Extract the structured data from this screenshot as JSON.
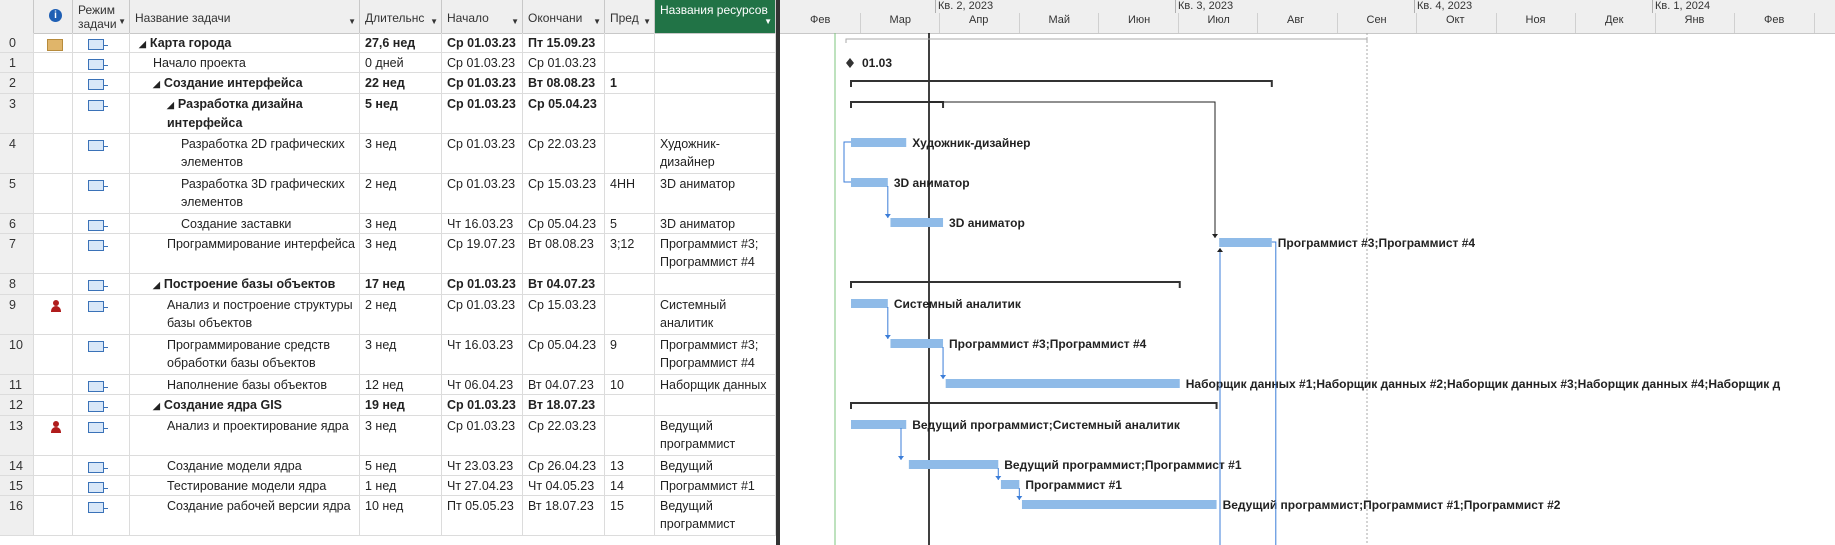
{
  "columns": {
    "info": "i",
    "mode": "Режим задачи",
    "name": "Название задачи",
    "duration": "Длительнс",
    "start": "Начало",
    "finish": "Окончани",
    "pred": "Пред",
    "resources": "Названия ресурсов"
  },
  "tasks": [
    {
      "id": "0",
      "name": "Карта города",
      "duration": "27,6 нед",
      "start": "Ср 01.03.23",
      "finish": "Пт 15.09.23",
      "pred": "",
      "resources": ""
    },
    {
      "id": "1",
      "name": "Начало проекта",
      "duration": "0 дней",
      "start": "Ср 01.03.23",
      "finish": "Ср 01.03.23",
      "pred": "",
      "resources": ""
    },
    {
      "id": "2",
      "name": "Создание интерфейса",
      "duration": "22 нед",
      "start": "Ср 01.03.23",
      "finish": "Вт 08.08.23",
      "pred": "1",
      "resources": ""
    },
    {
      "id": "3",
      "name": "Разработка дизайна интерфейса",
      "duration": "5 нед",
      "start": "Ср 01.03.23",
      "finish": "Ср 05.04.23",
      "pred": "",
      "resources": ""
    },
    {
      "id": "4",
      "name": "Разработка 2D графических элементов",
      "duration": "3 нед",
      "start": "Ср 01.03.23",
      "finish": "Ср 22.03.23",
      "pred": "",
      "resources": "Художник-дизайнер"
    },
    {
      "id": "5",
      "name": "Разработка 3D графических элементов",
      "duration": "2 нед",
      "start": "Ср 01.03.23",
      "finish": "Ср 15.03.23",
      "pred": "4НН",
      "resources": "3D аниматор"
    },
    {
      "id": "6",
      "name": "Создание заставки",
      "duration": "3 нед",
      "start": "Чт 16.03.23",
      "finish": "Ср 05.04.23",
      "pred": "5",
      "resources": "3D аниматор"
    },
    {
      "id": "7",
      "name": "Программирование интерфейса",
      "duration": "3 нед",
      "start": "Ср 19.07.23",
      "finish": "Вт 08.08.23",
      "pred": "3;12",
      "resources": "Программист #3; Программист #4"
    },
    {
      "id": "8",
      "name": "Построение базы объектов",
      "duration": "17 нед",
      "start": "Ср 01.03.23",
      "finish": "Вт 04.07.23",
      "pred": "",
      "resources": ""
    },
    {
      "id": "9",
      "name": "Анализ и построение структуры базы объектов",
      "duration": "2 нед",
      "start": "Ср 01.03.23",
      "finish": "Ср 15.03.23",
      "pred": "",
      "resources": "Системный аналитик"
    },
    {
      "id": "10",
      "name": "Программирование средств обработки базы объектов",
      "duration": "3 нед",
      "start": "Чт 16.03.23",
      "finish": "Ср 05.04.23",
      "pred": "9",
      "resources": "Программист #3; Программист #4"
    },
    {
      "id": "11",
      "name": "Наполнение базы объектов",
      "duration": "12 нед",
      "start": "Чт 06.04.23",
      "finish": "Вт 04.07.23",
      "pred": "10",
      "resources": "Наборщик данных"
    },
    {
      "id": "12",
      "name": "Создание ядра GIS",
      "duration": "19 нед",
      "start": "Ср 01.03.23",
      "finish": "Вт 18.07.23",
      "pred": "",
      "resources": ""
    },
    {
      "id": "13",
      "name": "Анализ и проектирование ядра",
      "duration": "3 нед",
      "start": "Ср 01.03.23",
      "finish": "Ср 22.03.23",
      "pred": "",
      "resources": "Ведущий программист"
    },
    {
      "id": "14",
      "name": "Создание модели ядра",
      "duration": "5 нед",
      "start": "Чт 23.03.23",
      "finish": "Ср 26.04.23",
      "pred": "13",
      "resources": "Ведущий программ"
    },
    {
      "id": "15",
      "name": "Тестирование модели ядра",
      "duration": "1 нед",
      "start": "Чт 27.04.23",
      "finish": "Чт 04.05.23",
      "pred": "14",
      "resources": "Программист #1"
    },
    {
      "id": "16",
      "name": "Создание рабочей версии ядра",
      "duration": "10 нед",
      "start": "Пт 05.05.23",
      "finish": "Вт 18.07.23",
      "pred": "15",
      "resources": "Ведущий программист"
    }
  ],
  "timeline": {
    "quarters": [
      "Кв. 2, 2023",
      "Кв. 3, 2023",
      "Кв. 4, 2023",
      "Кв. 1, 2024"
    ],
    "months": [
      "Фев",
      "Мар",
      "Апр",
      "Май",
      "Июн",
      "Июл",
      "Авг",
      "Сен",
      "Окт",
      "Ноя",
      "Дек",
      "Янв",
      "Фев"
    ]
  },
  "gantt_labels": {
    "milestone": "01.03",
    "t4": "Художник-дизайнер",
    "t5": "3D аниматор",
    "t6": "3D аниматор",
    "t7": "Программист #3;Программист #4",
    "t9": "Системный аналитик",
    "t10": "Программист #3;Программист #4",
    "t11": "Наборщик данных #1;Наборщик данных #2;Наборщик данных #3;Наборщик данных #4;Наборщик д",
    "t13": "Ведущий программист;Системный аналитик",
    "t14": "Ведущий программист;Программист #1",
    "t15": "Программист #1",
    "t16": "Ведущий программист;Программист #1;Программист #2"
  },
  "colors": {
    "bar": "#8fbbe8",
    "summary": "#333333",
    "link": "#3b7dd8",
    "resource_header": "#217346"
  }
}
